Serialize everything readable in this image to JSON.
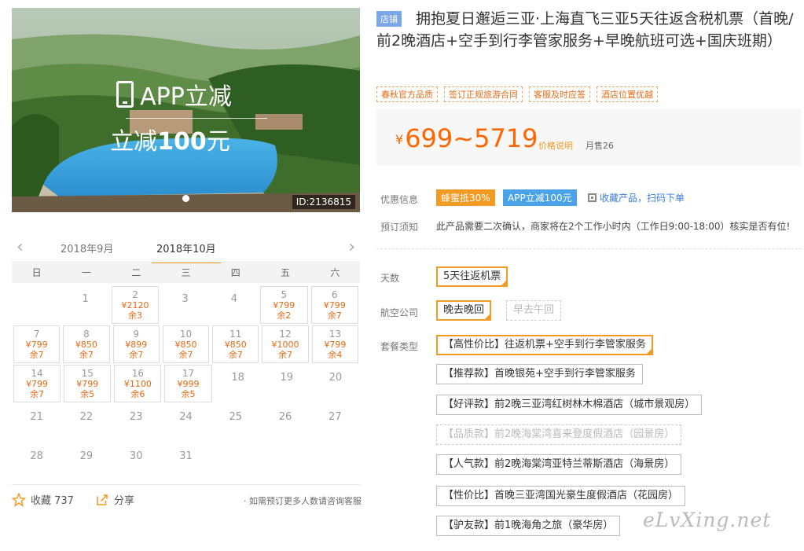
{
  "hero": {
    "badge_line1": "APP立减",
    "badge_line2_prefix": "立减",
    "badge_line2_amount": "100",
    "badge_line2_suffix": "元",
    "id_label": "ID:2136815"
  },
  "calendar": {
    "months": [
      "2018年9月",
      "2018年10月"
    ],
    "active_month": "2018年10月",
    "weekdays": [
      "日",
      "一",
      "二",
      "三",
      "四",
      "五",
      "六"
    ],
    "weeks": [
      [
        {
          "day": ""
        },
        {
          "day": "1"
        },
        {
          "day": "2",
          "price": "¥2120",
          "stock": "余3"
        },
        {
          "day": "3"
        },
        {
          "day": "4"
        },
        {
          "day": "5",
          "price": "¥799",
          "stock": "余2"
        },
        {
          "day": "6",
          "price": "¥799",
          "stock": "余7"
        }
      ],
      [
        {
          "day": "7",
          "price": "¥799",
          "stock": "余7"
        },
        {
          "day": "8",
          "price": "¥850",
          "stock": "余7"
        },
        {
          "day": "9",
          "price": "¥899",
          "stock": "余7"
        },
        {
          "day": "10",
          "price": "¥850",
          "stock": "余7"
        },
        {
          "day": "11",
          "price": "¥850",
          "stock": "余7"
        },
        {
          "day": "12",
          "price": "¥1000",
          "stock": "余7"
        },
        {
          "day": "13",
          "price": "¥799",
          "stock": "余4"
        }
      ],
      [
        {
          "day": "14",
          "price": "¥799",
          "stock": "余7"
        },
        {
          "day": "15",
          "price": "¥799",
          "stock": "余5"
        },
        {
          "day": "16",
          "price": "¥1100",
          "stock": "余6"
        },
        {
          "day": "17",
          "price": "¥999",
          "stock": "余5"
        },
        {
          "day": "18"
        },
        {
          "day": "19"
        },
        {
          "day": "20"
        }
      ],
      [
        {
          "day": "21"
        },
        {
          "day": "22"
        },
        {
          "day": "23"
        },
        {
          "day": "24"
        },
        {
          "day": "25"
        },
        {
          "day": "26"
        },
        {
          "day": "27"
        }
      ],
      [
        {
          "day": "28"
        },
        {
          "day": "29"
        },
        {
          "day": "30"
        },
        {
          "day": "31"
        },
        {
          "day": ""
        },
        {
          "day": ""
        },
        {
          "day": ""
        }
      ]
    ]
  },
  "footer": {
    "fav_label": "收藏 737",
    "share_label": "分享",
    "note": "· 如需预订更多人数请咨询客服"
  },
  "product": {
    "shop_tag": "店铺",
    "title": "拥抱夏日邂逅三亚·上海直飞三亚5天往返含税机票（首晚/前2晚酒店+空手到行李管家服务+早晚航班可选+国庆班期）",
    "tags": [
      "春秋官方品质",
      "签订正规旅游合同",
      "客服及时应答",
      "酒店位置优越"
    ],
    "price": "699~5719",
    "currency": "¥",
    "price_note": "价格说明",
    "monthly_sales": "月售26"
  },
  "info": {
    "promo_label": "优惠信息",
    "promo1": "蜂蜜抵30%",
    "promo2": "APP立减100元",
    "qr_link": "收藏产品，扫码下单",
    "notice_label": "预订须知",
    "notice": "此产品需要二次确认，商家将在2个工作小时内（工作日9:00-18:00）核实是否有位!"
  },
  "options": {
    "days_label": "天数",
    "days": [
      "5天往返机票"
    ],
    "airline_label": "航空公司",
    "airlines": [
      "晚去晚回",
      "早去午回"
    ],
    "package_label": "套餐类型",
    "packages": [
      "【高性价比】往返机票+空手到行李管家服务",
      "【推荐款】首晚银苑+空手到行李管家服务",
      "【好评款】前2晚三亚湾红树林木棉酒店（城市景观房）",
      "【品质款】前2晚海棠湾喜来登度假酒店（园景房）",
      "【人气款】前2晚海棠湾亚特兰蒂斯酒店（海景房）",
      "【性价比】首晚三亚湾国光豪生度假酒店（花园房）",
      "【驴友款】前1晚海角之旅（豪华房）"
    ]
  },
  "watermark": "eLvXing.net"
}
